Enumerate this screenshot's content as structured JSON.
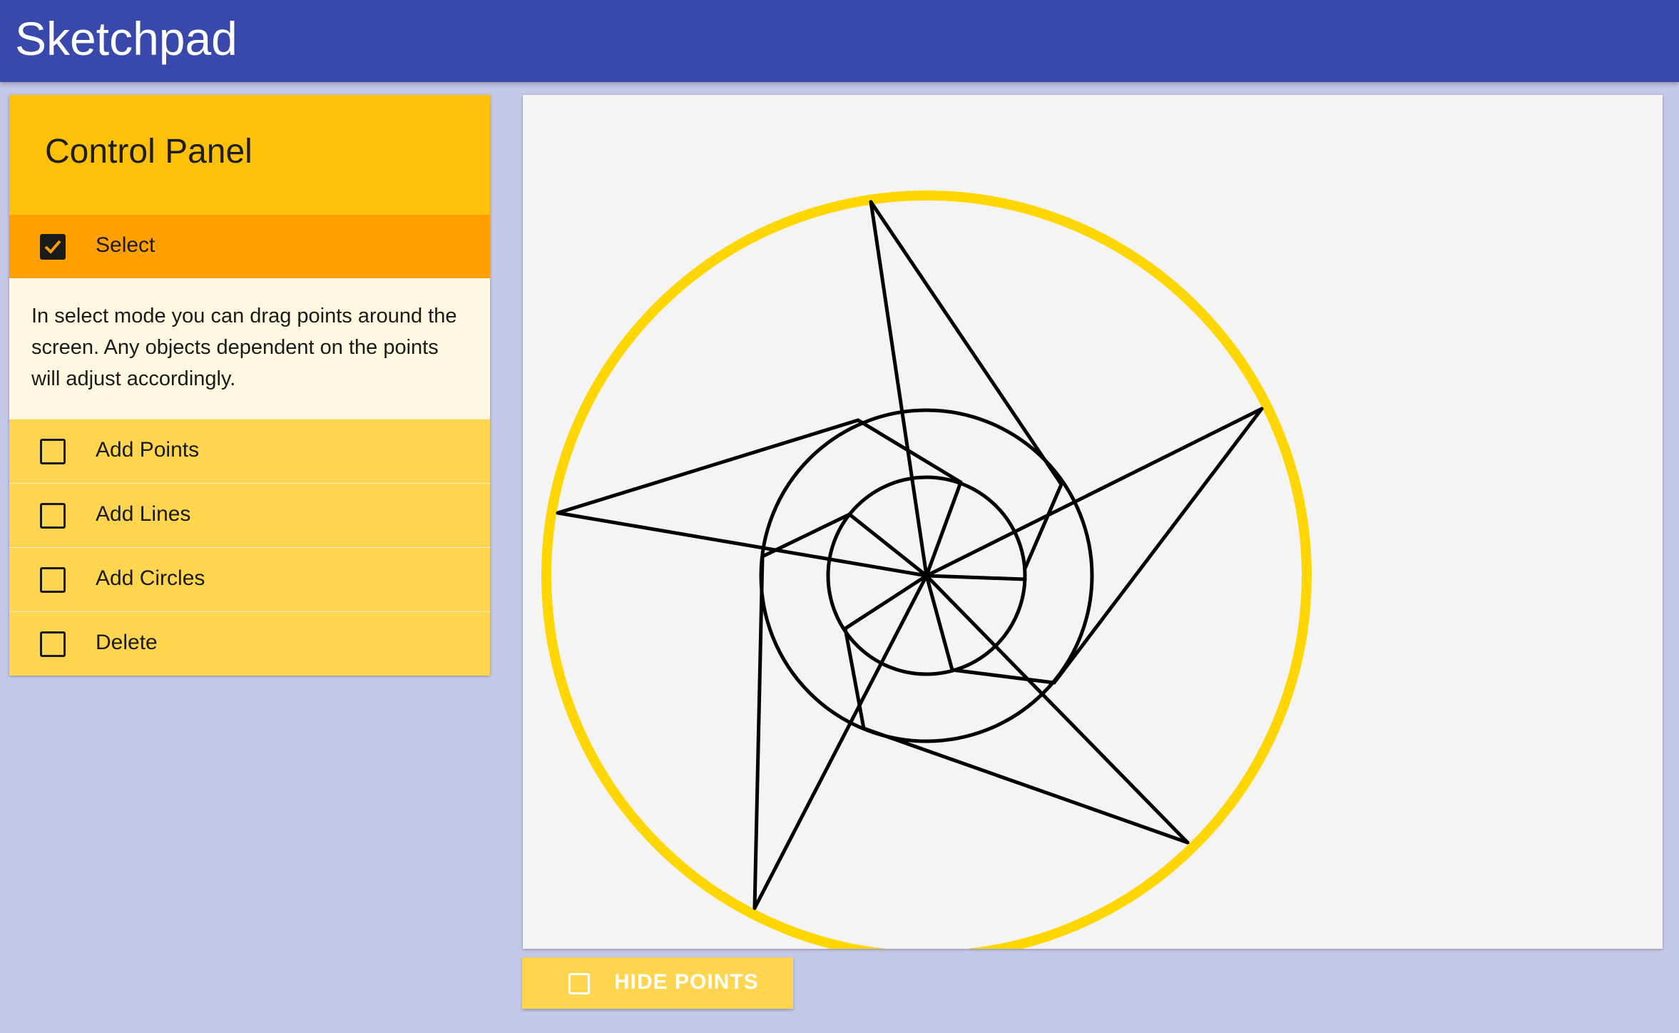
{
  "app": {
    "title": "Sketchpad"
  },
  "control_panel": {
    "title": "Control Panel",
    "modes": [
      {
        "label": "Select",
        "checked": true,
        "description": "In select mode you can drag points around the screen. Any objects dependent on the points will adjust accordingly."
      },
      {
        "label": "Add Points",
        "checked": false
      },
      {
        "label": "Add Lines",
        "checked": false
      },
      {
        "label": "Add Circles",
        "checked": false
      },
      {
        "label": "Delete",
        "checked": false
      }
    ]
  },
  "canvas": {
    "background": "#f4f4f4",
    "outer_circle_color": "#ffd600",
    "line_color": "#000000"
  },
  "hide_points_button": {
    "label": "HIDE POINTS",
    "checked": false
  },
  "colors": {
    "appbar": "#3949ab",
    "background": "#c5c8e8",
    "panel_header": "#ffc107",
    "active_row": "#ffa000",
    "row": "#ffd54f",
    "description_bg": "#fff8e1"
  }
}
